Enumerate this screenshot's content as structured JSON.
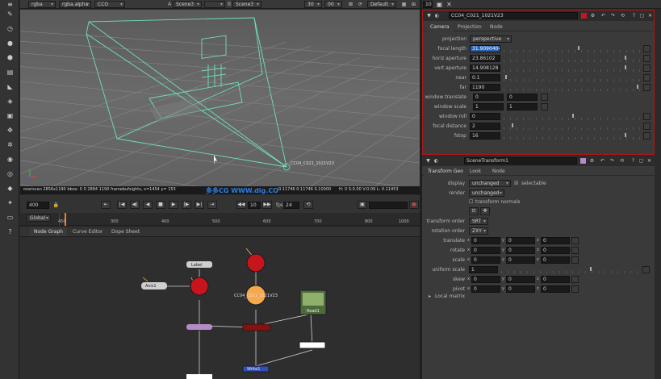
{
  "viewer": {
    "toolbar": {
      "layer_a": "rgba",
      "channel": "rgba.alpha",
      "view": "CCO",
      "input_a": "Scene3",
      "input_b": "Scene3",
      "zoom": "30",
      "frame_field": "00",
      "ratio": "1",
      "viewer_name": "Default"
    },
    "camera_label": "CC04_C021_1021V23",
    "overscan_text": "overscan 2856x1190 bbox: 0 0 2884 1190 framebufsights, x=1454 y= 153",
    "pixel_values": "0.11746   0.11746   0.10000",
    "pixel_hsv": "H: 0 S:0.00 V:0.09  L: 0.11453",
    "watermark": "多多CG WWW.dig.CO",
    "playback": {
      "fps_field": "400",
      "frame_current": "24",
      "inc_field": "10",
      "fps_label": "fps",
      "range_mode": "Global",
      "timeline_ticks": [
        "450",
        "300",
        "400",
        "500",
        "600",
        "700",
        "800",
        "900",
        "1000"
      ],
      "timeline_end": "1000"
    }
  },
  "node_graph": {
    "tabs": [
      "Node Graph",
      "Curve Editor",
      "Dope Sheet"
    ],
    "nodes": {
      "read": "Read1",
      "camera": "CC04_C021_1021V23",
      "write": "Write1",
      "label_box": "Label",
      "axis": "Axis1"
    }
  },
  "camera_panel": {
    "header_frame": "10",
    "title": "CC04_C021_1021V23",
    "tabs": [
      "Camera",
      "Projection",
      "Node"
    ],
    "params": [
      {
        "label": "projection",
        "value": "perspective",
        "type": "drop"
      },
      {
        "label": "focal length",
        "value": "31.9090404",
        "type": "field",
        "slider": true,
        "selected": true
      },
      {
        "label": "horiz aperture",
        "value": "23.86102",
        "type": "field",
        "slider": true
      },
      {
        "label": "vert aperture",
        "value": "14.908128",
        "type": "field",
        "slider": true
      },
      {
        "label": "near",
        "value": "0.1",
        "type": "field",
        "slider": true
      },
      {
        "label": "far",
        "value": "1190",
        "type": "field",
        "slider": true
      },
      {
        "label": "window translate",
        "value": "0",
        "value2": "0",
        "type": "pair"
      },
      {
        "label": "window scale",
        "value": "1",
        "value2": "1",
        "type": "pair"
      },
      {
        "label": "window roll",
        "value": "0",
        "type": "field",
        "slider": true
      },
      {
        "label": "focal distance",
        "value": "2",
        "type": "field",
        "slider": true
      },
      {
        "label": "fstop",
        "value": "16",
        "type": "field",
        "slider": true
      }
    ]
  },
  "scene_panel": {
    "title": "SceneTransform1",
    "tabs": [
      "Transform Geo",
      "Look",
      "Node"
    ],
    "display_label": "display",
    "display_value": "unchanged",
    "selectable_label": "selectable",
    "render_label": "render",
    "render_value": "unchanged",
    "transform_normals_label": "transform normals",
    "transform_order_label": "transform order",
    "transform_order_value": "SRT",
    "rotation_order_label": "rotation order",
    "rotation_order_value": "ZXY",
    "vectors": [
      {
        "label": "translate",
        "x": "0",
        "y": "0",
        "z": "0"
      },
      {
        "label": "rotate",
        "x": "0",
        "y": "0",
        "z": "0"
      },
      {
        "label": "scale",
        "x": "0",
        "y": "0",
        "z": "0"
      }
    ],
    "uniform_scale_label": "uniform scale",
    "uniform_scale_value": "1",
    "skew": {
      "label": "skew",
      "x": "0",
      "y": "0",
      "z": "0"
    },
    "pivot": {
      "label": "pivot",
      "x": "0",
      "y": "0",
      "z": "0"
    },
    "local_matrix_label": "Local matrix"
  }
}
